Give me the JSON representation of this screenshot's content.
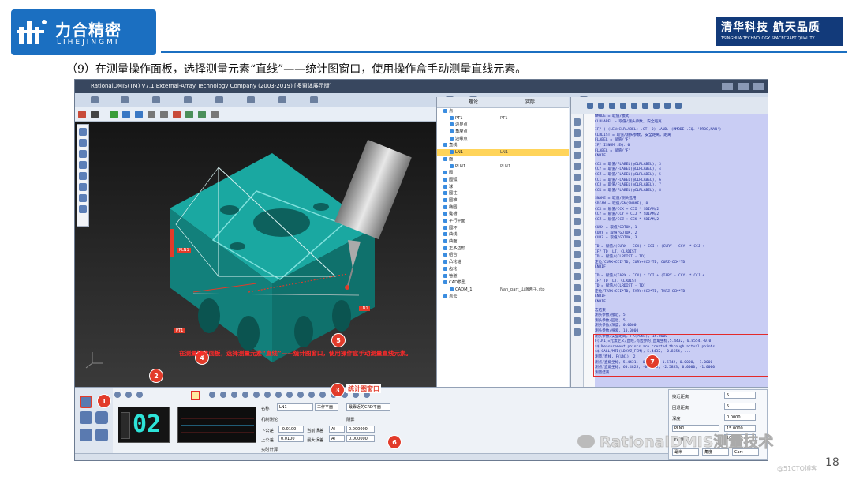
{
  "logo": {
    "cn": "力合精密",
    "en": "LIHEJINGMI"
  },
  "badge": {
    "cn": "清华科技 航天品质",
    "en": "TSINGHUA TECHNOLOGY SPACECRAFT QUALITY"
  },
  "instruction": "（9）在测量操作面板，选择测量元素“直线”——统计图窗口，使用操作盒手动测量直线元素。",
  "page_number": "18",
  "app": {
    "title": "RationalDMIS(TM) V7.1   External-Array Technology Company (2003-2019) [多窗体展示版]",
    "viewport_caption": "在测量操作面板，选择测量元素“直线”——统计图窗口，使用操作盒手动测量直线元素。",
    "callouts": [
      "1",
      "2",
      "3",
      "4",
      "5",
      "6",
      "7"
    ],
    "callout3_label": "统计图窗口",
    "feature_labels": {
      "pln1": "PLN1",
      "pt1": "PT1",
      "ln": "LN1"
    },
    "tree_headers": {
      "name": "理论",
      "actual": "实际"
    },
    "tree_rows": [
      {
        "name": "点",
        "c2": ""
      },
      {
        "name": "PT1",
        "c2": "PT1"
      },
      {
        "name": "边界点",
        "c2": ""
      },
      {
        "name": "角度点",
        "c2": ""
      },
      {
        "name": "边缘点",
        "c2": ""
      },
      {
        "name": "直线",
        "c2": ""
      },
      {
        "name": "LN1",
        "c2": "LN1"
      },
      {
        "name": "面",
        "c2": ""
      },
      {
        "name": "PLN1",
        "c2": "PLN1"
      },
      {
        "name": "圆",
        "c2": ""
      },
      {
        "name": "圆弧",
        "c2": ""
      },
      {
        "name": "球",
        "c2": ""
      },
      {
        "name": "圆柱",
        "c2": ""
      },
      {
        "name": "圆锥",
        "c2": ""
      },
      {
        "name": "椭圆",
        "c2": ""
      },
      {
        "name": "键槽",
        "c2": ""
      },
      {
        "name": "平行平面",
        "c2": ""
      },
      {
        "name": "圆环",
        "c2": ""
      },
      {
        "name": "曲线",
        "c2": ""
      },
      {
        "name": "曲面",
        "c2": ""
      },
      {
        "name": "正多边形",
        "c2": ""
      },
      {
        "name": "组合",
        "c2": ""
      },
      {
        "name": "凸轮轴",
        "c2": ""
      },
      {
        "name": "齿轮",
        "c2": ""
      },
      {
        "name": "管道",
        "c2": ""
      },
      {
        "name": "CAD模型",
        "c2": ""
      },
      {
        "name": "CADM_1",
        "c2": "Nan_part_山演两子.stp"
      },
      {
        "name": "点云",
        "c2": ""
      }
    ],
    "code_lines": [
      "MMODE = 取值/模式",
      "CLRLABEL = 取值/测头参数, 安全距离",
      "",
      "IF/ ( (LEN(CLRLABEL) .GT. 0) .AND. (MMODE .EQ. 'PROG,MAN')",
      "   CLRDIST = 取值/测头参数, 安全距离, 距离",
      "   FLABEL = 赋值/'F'",
      "   IF/ ISNUM .EQ. 0",
      "      FLABEL = 赋值/'F'",
      "   ENDIF",
      "",
      "   CCX = 取值/FLABEL(@CLRLABEL), 3",
      "   CCY = 取值/FLABEL(@CLRLABEL), 4",
      "   CCZ = 取值/FLABEL(@CLRLABEL), 5",
      "   CCI = 取值/FLABEL(@CLRLABEL), 6",
      "   CCJ = 取值/FLABEL(@CLRLABEL), 7",
      "   CCK = 取值/FLABEL(@CLRLABEL), 8",
      "",
      "   SNAME = 取值/测头选用",
      "   SDIAM = 取值/SN(SNAME), 8",
      "   CCX = 赋值/CCX + CCI * SDIAM/2",
      "   CCY = 赋值/CCY + CCJ * SDIAM/2",
      "   CCZ = 赋值/CCZ + CCK * SDIAM/2",
      "",
      "   CURX = 取值/GOTOK, 1",
      "   CURY = 取值/GOTOK, 2",
      "   CURZ = 取值/GOTOK, 3",
      "",
      "   TD = 赋值/(CURX - CCX) * CCI + (CURY - CCY) * CCJ +",
      "   IF/ TD .LT. CLRDIST",
      "      TD = 赋值/(CLRDIST - TD)",
      "      定位/CURX+CCI*TD, CURY+CCJ*TD, CURZ+CCK*TD",
      "   ENDIF",
      "",
      "   TD = 赋值/(TARX - CCX) * CCI + (TARY - CCY) * CCJ +",
      "   IF/ TD .LT. CLRDIST",
      "      TD = 赋值/(CLRDIST - TD)",
      "      定位/TARX+CCI*TD, TARY+CCJ*TD, TARZ+CCK*TD",
      "   ENDIF",
      "ENDIF",
      "",
      "宏结束",
      "测头参数/接近, 5",
      "测头参数/回退, 5",
      "测头参数/深度, 0.0000",
      "测头参数/搜索, 10.0000",
      "测头参数/安全距离, FA(PLN1), 15.0000",
      "F(LN1)=元素定义/直线,有边界的,直角坐标,5.4432,-0.8554,-0.0",
      "$$ Measurement points are created through actual points",
      "$$ CALL/MTD(LDXYZ_FEM), 5.4432, -0.8554, ...",
      "测量/直线, F(LN1), 2",
      "   测点/直角坐标, 5.4431, -0.8556, -1.5742, 0.0000, -1.0000",
      "   测点/直角坐标, 60.4825, -0.8556, -2.5853, 0.0000, -1.0000",
      "测量结束"
    ],
    "bottom": {
      "counter": "02",
      "name_label": "名称",
      "name_value": "LN1",
      "workplane_label": "工作平面",
      "workplane_value": "最靠近的CRD平面",
      "probe_comp_label": "机制测论",
      "shadow_label": "阴影",
      "lower_tol_label": "下公差",
      "lower_tol_value": "-0.0100",
      "upper_tol_label": "上公差",
      "upper_tol_value": "0.0100",
      "cur_err_label": "当前误差",
      "max_err_label": "最大误差",
      "ai_label": "AI",
      "ai_value_1": "0.000000",
      "ai_value_2": "0.000000",
      "realtime_label": "实时计算",
      "approach_label": "接近距离",
      "approach_value": "5",
      "retract_label": "回退距离",
      "retract_value": "5",
      "depth_label": "深度",
      "depth_value": "0.0000",
      "clearance_plane": "PLN1",
      "clearance_value": "15.0000",
      "search_label": "搜索距离",
      "search_value": "10.0000",
      "unit_mm": "毫米",
      "unit_angle": "角度",
      "coord": "Cart"
    }
  },
  "wechat": {
    "text": "RationalDMIS测量技术"
  },
  "watermark": "@51CTO博客"
}
